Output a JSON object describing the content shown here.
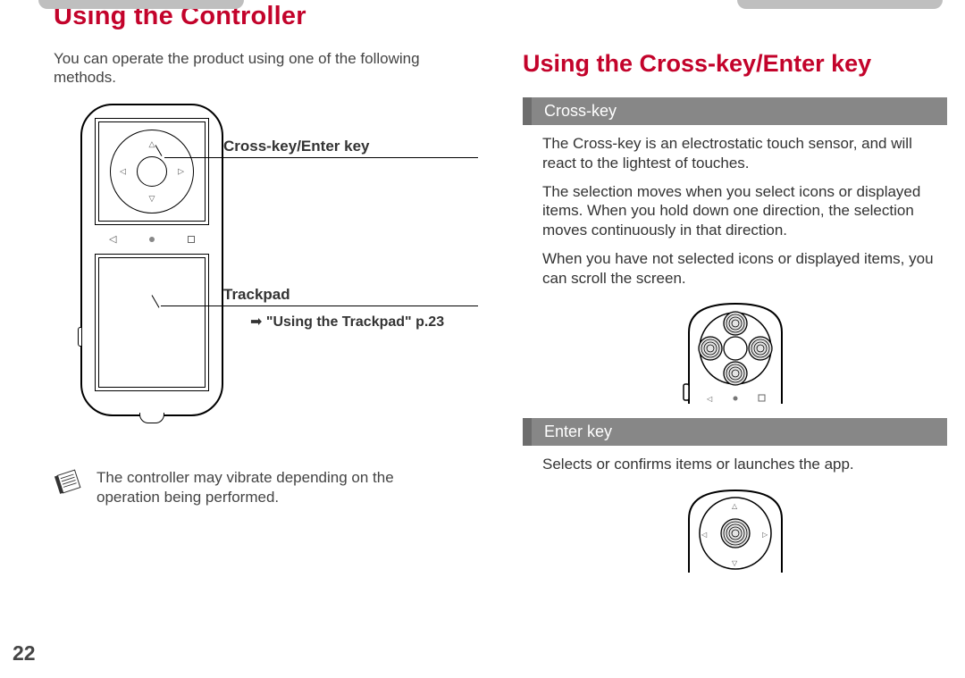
{
  "page": {
    "title": "Using the Controller",
    "intro": "You can operate the product using one of the following methods.",
    "number": "22"
  },
  "callouts": {
    "crosskey": "Cross-key/Enter key",
    "trackpad": "Trackpad",
    "trackpad_ref_arrow": "➡",
    "trackpad_ref": "\"Using the Trackpad\" p.23"
  },
  "note": {
    "text": "The controller may vibrate depending on the operation being performed."
  },
  "right": {
    "section_title": "Using the Cross-key/Enter key",
    "crosskey_header": "Cross-key",
    "crosskey_p1": "The Cross-key is an electrostatic touch sensor, and will react to the lightest of touches.",
    "crosskey_p2": "The selection moves when you select icons or displayed items. When you hold down one direction, the selection moves continuously in that direction.",
    "crosskey_p3": "When you have not selected icons or displayed items, you can scroll the screen.",
    "enter_header": "Enter key",
    "enter_p1": "Selects or confirms items or launches the app."
  }
}
